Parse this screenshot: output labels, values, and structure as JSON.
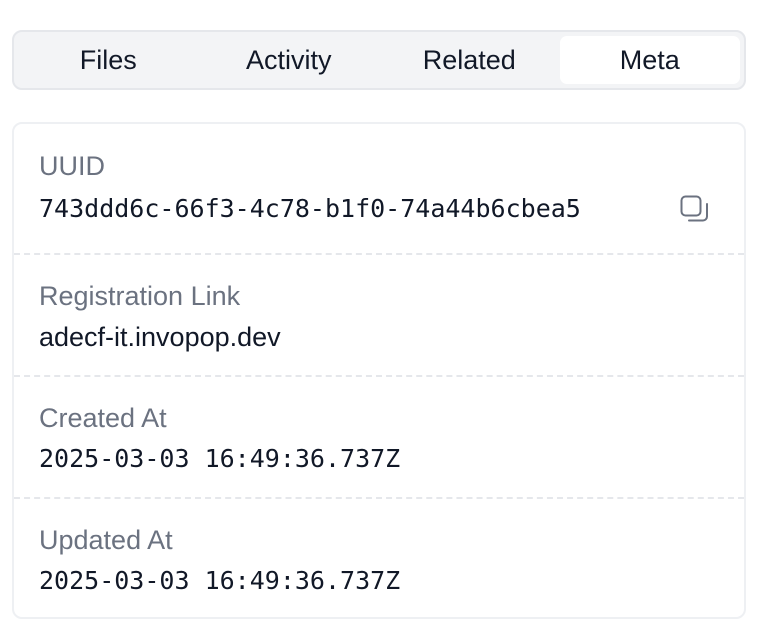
{
  "tabs": [
    {
      "label": "Files",
      "active": false
    },
    {
      "label": "Activity",
      "active": false
    },
    {
      "label": "Related",
      "active": false
    },
    {
      "label": "Meta",
      "active": true
    }
  ],
  "meta": {
    "uuid": {
      "label": "UUID",
      "value": "743ddd6c-66f3-4c78-b1f0-74a44b6cbea5"
    },
    "registration_link": {
      "label": "Registration Link",
      "value": "adecf-it.invopop.dev"
    },
    "created_at": {
      "label": "Created At",
      "value": "2025-03-03 16:49:36.737Z"
    },
    "updated_at": {
      "label": "Updated At",
      "value": "2025-03-03 16:49:36.737Z"
    }
  },
  "icons": {
    "copy": "copy-icon"
  },
  "colors": {
    "tab_bg": "#f3f4f6",
    "label": "#6b7280",
    "text": "#111827",
    "border": "#e5e7eb"
  }
}
